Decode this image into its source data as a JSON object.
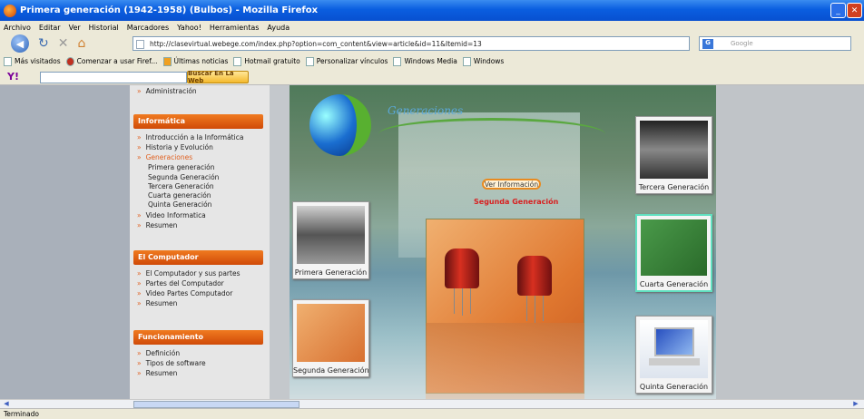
{
  "window": {
    "title": "Primera generación (1942-1958) (Bulbos) - Mozilla Firefox"
  },
  "menu": [
    "Archivo",
    "Editar",
    "Ver",
    "Historial",
    "Marcadores",
    "Yahoo!",
    "Herramientas",
    "Ayuda"
  ],
  "nav": {
    "url": "http://clasevirtual.webege.com/index.php?option=com_content&view=article&id=11&Itemid=13",
    "search_placeholder": "Google"
  },
  "bookmarks": [
    "Más visitados",
    "Comenzar a usar Firef...",
    "Últimas noticias",
    "Hotmail gratuito",
    "Personalizar vínculos",
    "Windows Media",
    "Windows"
  ],
  "yahoo": {
    "logo": "Y!",
    "button": "Buscar En La Web"
  },
  "sidebar": {
    "top_item": "Administración",
    "sections": [
      {
        "title": "Informática",
        "items": [
          "Introducción a la Informática",
          "Historia y Evolución",
          "Generaciones"
        ],
        "subitems": [
          "Primera generación",
          "Segunda Generación",
          "Tercera Generación",
          "Cuarta generación",
          "Quinta Generación"
        ],
        "after": [
          "Video Informatica",
          "Resumen"
        ]
      },
      {
        "title": "El Computador",
        "items": [
          "El Computador y sus partes",
          "Partes del Computador",
          "Video Partes Computador",
          "Resumen"
        ]
      },
      {
        "title": "Funcionamiento",
        "items": [
          "Definición",
          "Tipos de software",
          "Resumen"
        ]
      }
    ]
  },
  "main": {
    "heading": "Generaciones",
    "ver_info": "Ver Información",
    "selected_label": "Segunda Generación",
    "thumbs": {
      "primera": "Primera Generación",
      "segunda": "Segunda Generación",
      "tercera": "Tercera  Generación",
      "cuarta": "Cuarta Generación",
      "quinta": "Quinta Generación"
    }
  },
  "status": "Terminado"
}
